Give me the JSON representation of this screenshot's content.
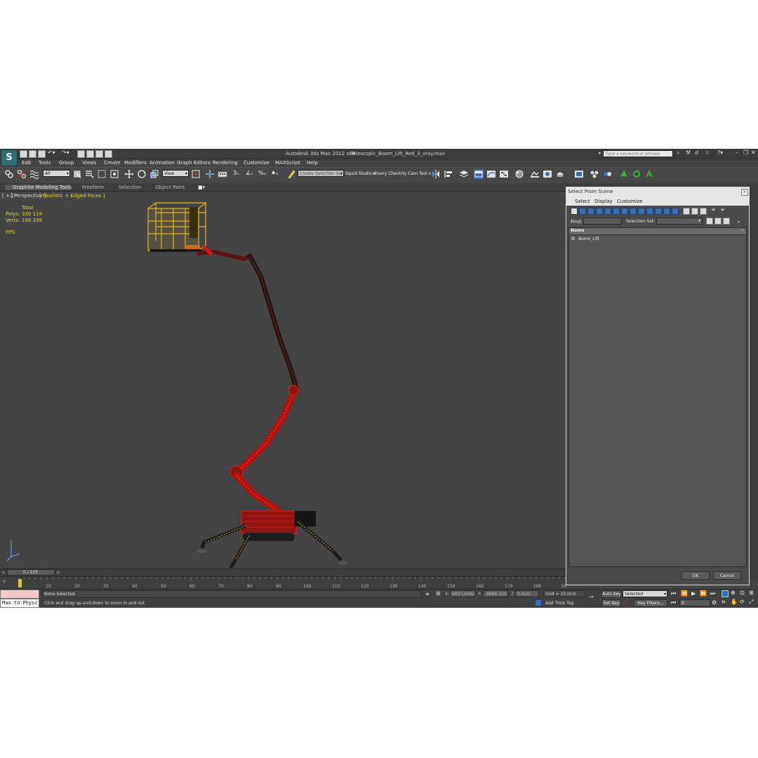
{
  "titlebar": {
    "app_title": "Autodesk 3ds Max  2012 x64",
    "file_name": "Telescopic_Boom_Lift_Red_3_vray.max",
    "search_placeholder": "Type a keyword or phrase"
  },
  "menubar": [
    "Edit",
    "Tools",
    "Group",
    "Views",
    "Create",
    "Modifiers",
    "Animation",
    "Graph Editors",
    "Rendering",
    "Customize",
    "MAXScript",
    "Help"
  ],
  "toolbar": {
    "filter_value": "All",
    "coord_value": "View",
    "selection_set_placeholder": "Create Selection Se",
    "squid_label": "Squid Studio v",
    "delivery_label": "elivery Check",
    "utility_label": "ity Cam Tool v"
  },
  "ribbon": {
    "tabs": [
      "Graphite Modeling Tools",
      "Freeform",
      "Selection",
      "Object Paint"
    ]
  },
  "viewport": {
    "label_plus": "[ + ]",
    "label_view": "[ Perspective ]",
    "label_mode": "[ Realistic + Edged Faces ]",
    "stats_header": "Total",
    "polys_label": "Polys:",
    "polys_value": "330 114",
    "verts_label": "Verts:",
    "verts_value": "168 339",
    "fps_label": "FPS:"
  },
  "timeline": {
    "frame_readout": "0 / 225",
    "ticks": [
      "10",
      "20",
      "30",
      "40",
      "50",
      "60",
      "70",
      "80",
      "90",
      "100",
      "110",
      "120",
      "130",
      "140",
      "150",
      "160",
      "170",
      "180",
      "19"
    ]
  },
  "status": {
    "script_listener": "Max to Physc",
    "selection_text": "None Selected",
    "prompt_text": "Click and drag up-and-down to zoom in and out",
    "x_label": "X:",
    "x_value": "9837,9492",
    "y_label": "Y:",
    "y_value": "-8686,310",
    "z_label": "Z:",
    "z_value": "0,0cm",
    "grid_text": "Grid = 10,0cm",
    "add_time_tag": "Add Time Tag",
    "auto_key": "Auto Key",
    "set_key": "Set Key",
    "key_mode_value": "Selected",
    "key_filters": "Key Filters...",
    "frame_value": "0"
  },
  "dialog": {
    "title": "Select From Scene",
    "menus": [
      "Select",
      "Display",
      "Customize"
    ],
    "find_label": "Find:",
    "selection_set_label": "Selection Set:",
    "column_header": "Name",
    "items": [
      {
        "name": "Boom_Lift"
      }
    ],
    "ok_label": "OK",
    "cancel_label": "Cancel"
  },
  "colors": {
    "viewport_bg": "#444444",
    "model_red": "#d11a14",
    "basket_yellow": "#e0b51f",
    "boom_dark": "#241514",
    "dialog_icon_blue": "#3a70b8",
    "vp_text_yellow": "#e6d640"
  }
}
